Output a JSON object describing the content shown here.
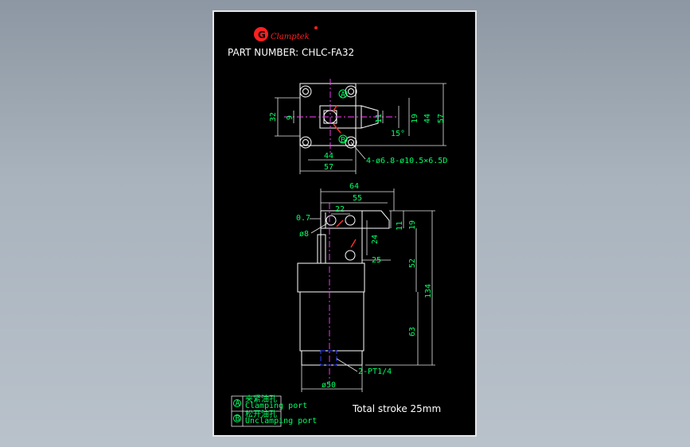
{
  "brand": {
    "logo_text": "Clamptek",
    "logo_mark": "G"
  },
  "part_number": "PART NUMBER: CHLC-FA32",
  "dims_top_view": {
    "d32": "32",
    "d9": "9",
    "d11": "11",
    "d19": "19",
    "d44v": "44",
    "d57v": "57",
    "angle": "15°",
    "d44h": "44",
    "d57h": "57",
    "holes": "4-ø6.8-ø10.5×6.5D"
  },
  "dims_side_view": {
    "d64": "64",
    "d55": "55",
    "d22": "22",
    "d07": "0.7",
    "d8": "ø8",
    "d24": "24",
    "d11": "11",
    "d19": "19",
    "d25": "25",
    "d52": "52",
    "d134": "134",
    "d63": "63",
    "port": "2-PT1/4",
    "d50": "ø50"
  },
  "stroke_note": "Total stroke 25mm",
  "legend": {
    "a_mark": "A",
    "a_cn": "夹紧油孔",
    "a_en": "Clamping port",
    "b_mark": "B",
    "b_cn": "松开油孔",
    "b_en": "Unclamping port"
  },
  "colors": {
    "dimension_text": "#00ff66",
    "outline": "#ffffff",
    "port": "#3040ff",
    "logo": "#ff2020"
  }
}
